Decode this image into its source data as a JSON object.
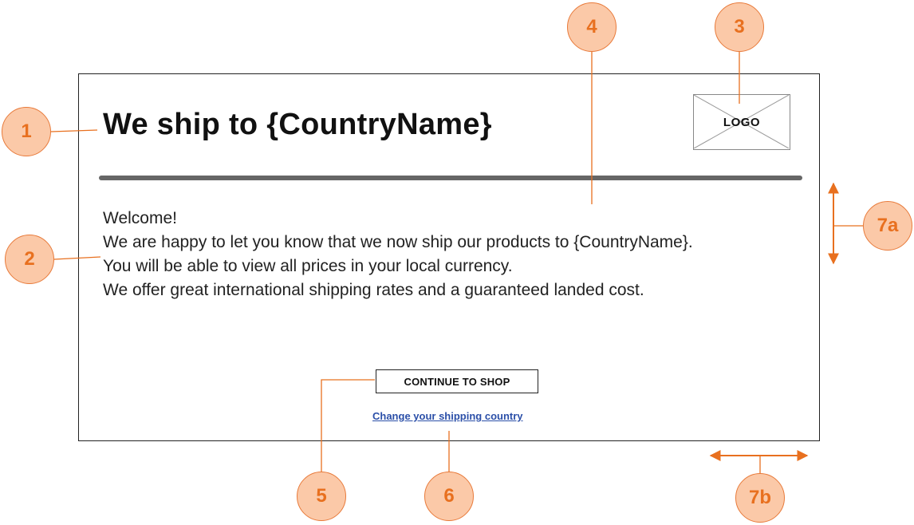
{
  "modal": {
    "title": "We ship to {CountryName}",
    "logo_label": "LOGO",
    "body_lines": [
      "Welcome!",
      "We are happy to let you know that we now ship our products to {CountryName}.",
      "You will be able to view all prices in your local currency.",
      "We offer great international shipping rates and a guaranteed landed cost."
    ],
    "continue_button_label": "CONTINUE TO SHOP",
    "change_country_link": "Change your shipping country"
  },
  "callouts": {
    "c1": "1",
    "c2": "2",
    "c3": "3",
    "c4": "4",
    "c5": "5",
    "c6": "6",
    "c7a": "7a",
    "c7b": "7b"
  },
  "colors": {
    "callout_fill": "#fbc9a8",
    "callout_stroke": "#e87a3a",
    "callout_text": "#e8701f",
    "leader_line": "#e8701f",
    "link": "#2b4fa8",
    "divider": "#666666"
  }
}
